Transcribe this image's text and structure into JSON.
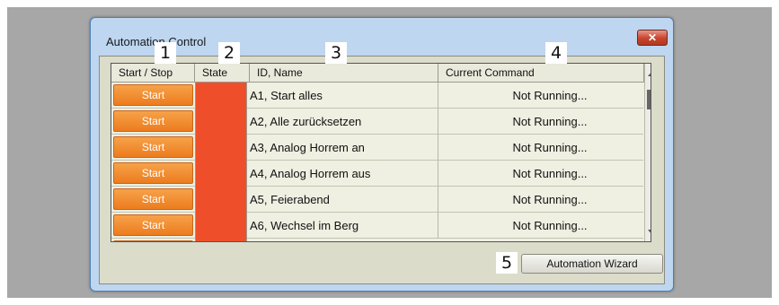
{
  "window": {
    "title": "Automation Control",
    "close_glyph": "✕"
  },
  "grid": {
    "columns": [
      "Start / Stop",
      "State",
      "ID, Name",
      "Current Command"
    ],
    "rows": [
      {
        "button": "Start",
        "name": "A1, Start alles",
        "command": "Not Running...",
        "state_color": "#ee4f2a"
      },
      {
        "button": "Start",
        "name": "A2, Alle zurücksetzen",
        "command": "Not Running...",
        "state_color": "#ee4f2a"
      },
      {
        "button": "Start",
        "name": "A3, Analog Horrem an",
        "command": "Not Running...",
        "state_color": "#ee4f2a"
      },
      {
        "button": "Start",
        "name": "A4, Analog Horrem aus",
        "command": "Not Running...",
        "state_color": "#ee4f2a"
      },
      {
        "button": "Start",
        "name": "A5, Feierabend",
        "command": "Not Running...",
        "state_color": "#ee4f2a"
      },
      {
        "button": "Start",
        "name": "A6, Wechsel im Berg",
        "command": "Not Running...",
        "state_color": "#ee4f2a"
      }
    ]
  },
  "footer": {
    "wizard_label": "Automation Wizard"
  },
  "callouts": [
    "1",
    "2",
    "3",
    "4",
    "5"
  ],
  "colors": {
    "start_button": "#ec7c1e",
    "state_stopped": "#ee4f2a",
    "window_frame": "#bed6f0",
    "close_button": "#c8442c"
  }
}
